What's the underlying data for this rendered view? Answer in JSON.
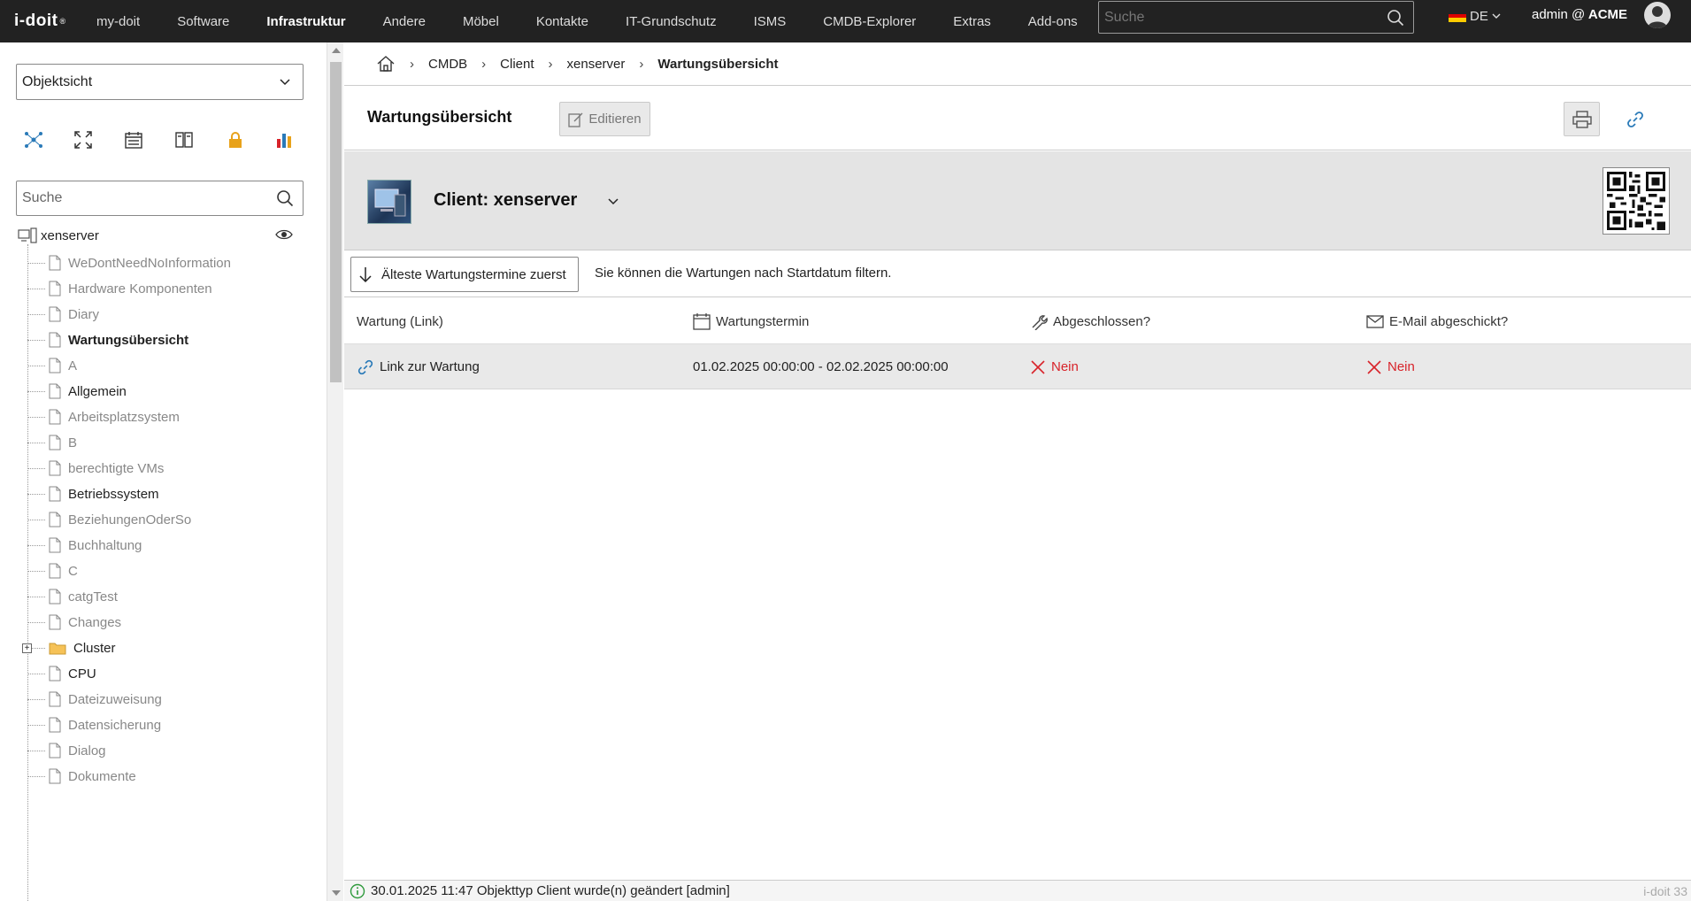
{
  "app": {
    "logo": "i-doit",
    "version": "i-doit 33"
  },
  "nav": {
    "items": [
      {
        "label": "my-doit",
        "active": false
      },
      {
        "label": "Software",
        "active": false
      },
      {
        "label": "Infrastruktur",
        "active": true
      },
      {
        "label": "Andere",
        "active": false
      },
      {
        "label": "Möbel",
        "active": false
      },
      {
        "label": "Kontakte",
        "active": false
      },
      {
        "label": "IT-Grundschutz",
        "active": false
      },
      {
        "label": "ISMS",
        "active": false
      },
      {
        "label": "CMDB-Explorer",
        "active": false
      },
      {
        "label": "Extras",
        "active": false
      },
      {
        "label": "Add-ons",
        "active": false
      }
    ],
    "search_placeholder": "Suche",
    "language": "DE",
    "user_prefix": "admin @",
    "tenant": "ACME"
  },
  "sidebar": {
    "view_select": "Objektsicht",
    "search_placeholder": "Suche",
    "icons": [
      "relations-icon",
      "fullscreen-icon",
      "calendar-icon",
      "book-icon",
      "lock-icon",
      "chart-icon"
    ],
    "tree_root": "xenserver",
    "items": [
      {
        "label": "WeDontNeedNoInformation",
        "style": "muted",
        "type": "page"
      },
      {
        "label": "Hardware Komponenten",
        "style": "muted",
        "type": "page"
      },
      {
        "label": "Diary",
        "style": "muted",
        "type": "page"
      },
      {
        "label": "Wartungsübersicht",
        "style": "bold",
        "type": "page"
      },
      {
        "label": "A",
        "style": "muted",
        "type": "page"
      },
      {
        "label": "Allgemein",
        "style": "normal",
        "type": "page"
      },
      {
        "label": "Arbeitsplatzsystem",
        "style": "muted",
        "type": "page"
      },
      {
        "label": "B",
        "style": "muted",
        "type": "page"
      },
      {
        "label": "berechtigte VMs",
        "style": "muted",
        "type": "page"
      },
      {
        "label": "Betriebssystem",
        "style": "normal",
        "type": "page"
      },
      {
        "label": "BeziehungenOderSo",
        "style": "muted",
        "type": "page"
      },
      {
        "label": "Buchhaltung",
        "style": "muted",
        "type": "page"
      },
      {
        "label": "C",
        "style": "muted",
        "type": "page"
      },
      {
        "label": "catgTest",
        "style": "muted",
        "type": "page"
      },
      {
        "label": "Changes",
        "style": "muted",
        "type": "page"
      },
      {
        "label": "Cluster",
        "style": "normal",
        "type": "folder"
      },
      {
        "label": "CPU",
        "style": "normal",
        "type": "page"
      },
      {
        "label": "Dateizuweisung",
        "style": "muted",
        "type": "page"
      },
      {
        "label": "Datensicherung",
        "style": "muted",
        "type": "page"
      },
      {
        "label": "Dialog",
        "style": "muted",
        "type": "page"
      },
      {
        "label": "Dokumente",
        "style": "muted",
        "type": "page"
      }
    ]
  },
  "breadcrumb": {
    "items": [
      "CMDB",
      "Client",
      "xenserver",
      "Wartungsübersicht"
    ]
  },
  "toolbar": {
    "title": "Wartungsübersicht",
    "edit_label": "Editieren"
  },
  "object": {
    "title": "Client: xenserver"
  },
  "filter": {
    "sort_label": "Älteste Wartungstermine zuerst",
    "hint": "Sie können die Wartungen nach Startdatum filtern."
  },
  "table": {
    "headers": [
      "Wartung (Link)",
      "Wartungstermin",
      "Abgeschlossen?",
      "E-Mail abgeschickt?"
    ],
    "rows": [
      {
        "link": "Link zur Wartung",
        "date": "01.02.2025 00:00:00 - 02.02.2025 00:00:00",
        "done": "Nein",
        "mail": "Nein"
      }
    ]
  },
  "status": {
    "message": "30.01.2025 11:47 Objekttyp Client wurde(n) geändert [admin]"
  },
  "colors": {
    "accent": "#2a7ab8",
    "error": "#d8232a",
    "topbar": "#222222"
  }
}
